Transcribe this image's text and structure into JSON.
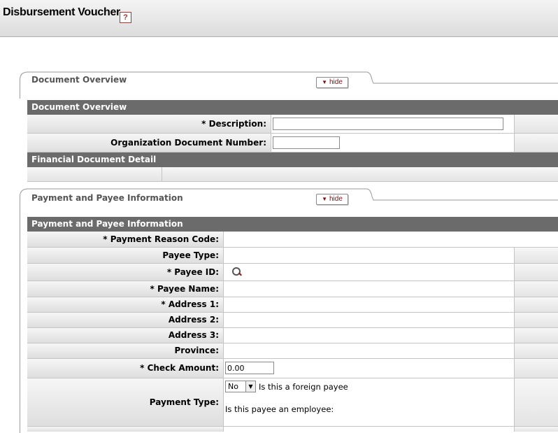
{
  "header": {
    "title": "Disbursement Voucher",
    "help_label": "?"
  },
  "document_overview": {
    "tab_title": "Document Overview",
    "hide_label": "hide",
    "section_title": "Document Overview",
    "description_label": "* Description:",
    "description_value": "",
    "org_doc_number_label": "Organization Document Number:",
    "org_doc_number_value": "",
    "financial_detail_title": "Financial Document Detail"
  },
  "payment": {
    "tab_title": "Payment and Payee Information",
    "hide_label": "hide",
    "section_title": "Payment and Payee Information",
    "payment_reason_code_label": "* Payment Reason Code:",
    "payee_type_label": "Payee Type:",
    "payee_id_label": "* Payee ID:",
    "payee_name_label": "* Payee Name:",
    "address1_label": "* Address 1:",
    "address2_label": "Address 2:",
    "address3_label": "Address 3:",
    "province_label": "Province:",
    "check_amount_label": "* Check Amount:",
    "check_amount_value": "0.00",
    "payment_type_label": "Payment Type:",
    "foreign_select_value": "No",
    "foreign_text": "Is this a foreign payee",
    "employee_text": "Is this payee an employee:"
  }
}
